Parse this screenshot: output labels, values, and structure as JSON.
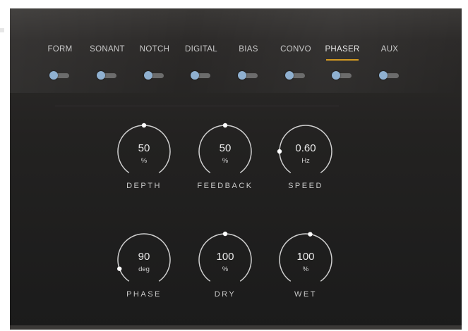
{
  "tabs": [
    {
      "label": "FORM",
      "active": false
    },
    {
      "label": "SONANT",
      "active": false
    },
    {
      "label": "NOTCH",
      "active": false
    },
    {
      "label": "DIGITAL",
      "active": false
    },
    {
      "label": "BIAS",
      "active": false
    },
    {
      "label": "CONVO",
      "active": false
    },
    {
      "label": "PHASER",
      "active": true
    },
    {
      "label": "AUX",
      "active": false
    }
  ],
  "knobs": [
    {
      "label": "DEPTH",
      "value": "50",
      "unit": "%",
      "indicator_angle_deg": 0
    },
    {
      "label": "FEEDBACK",
      "value": "50",
      "unit": "%",
      "indicator_angle_deg": 0
    },
    {
      "label": "SPEED",
      "value": "0.60",
      "unit": "Hz",
      "indicator_angle_deg": -90
    },
    {
      "label": "PHASE",
      "value": "90",
      "unit": "deg",
      "indicator_angle_deg": -110
    },
    {
      "label": "DRY",
      "value": "100",
      "unit": "%",
      "indicator_angle_deg": 0
    },
    {
      "label": "WET",
      "value": "100",
      "unit": "%",
      "indicator_angle_deg": 10
    }
  ],
  "colors": {
    "accent": "#d49a21",
    "toggle_knob": "#8fb0d0",
    "text": "#c9c9c9"
  }
}
